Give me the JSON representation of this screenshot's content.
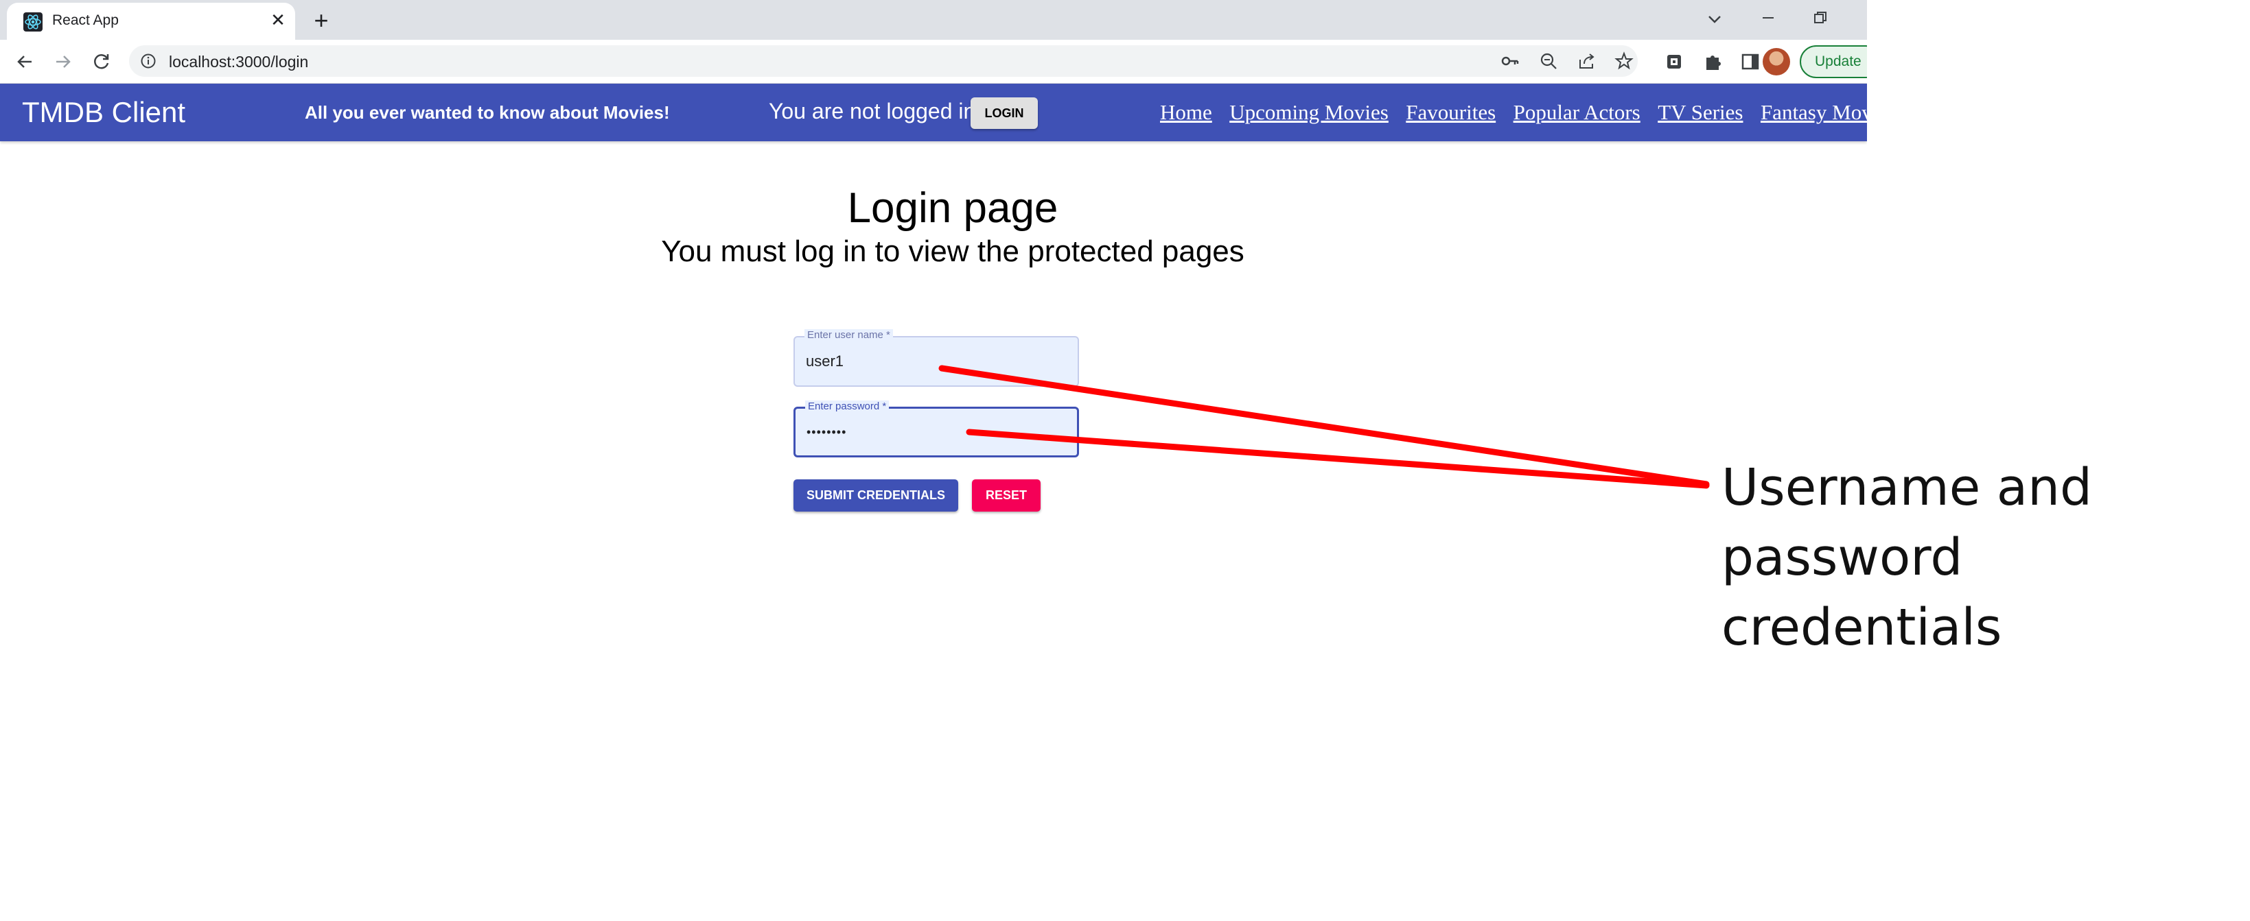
{
  "browser": {
    "tab_title": "React App",
    "tab_close": "✕",
    "new_tab": "+",
    "url": "localhost:3000/login",
    "update_label": "Update"
  },
  "appbar": {
    "title": "TMDB Client",
    "tagline": "All you ever wanted to know about Movies!",
    "login_status": "You are not logged in",
    "login_button": "LOGIN",
    "nav": [
      "Home",
      "Upcoming Movies",
      "Favourites",
      "Popular Actors",
      "TV Series",
      "Fantasy Movies"
    ]
  },
  "main": {
    "heading": "Login page",
    "subheading": "You must log in to view the protected pages",
    "username": {
      "label": "Enter user name *",
      "value": "user1"
    },
    "password": {
      "label": "Enter password *",
      "value": "••••••••"
    },
    "submit_label": "SUBMIT CREDENTIALS",
    "reset_label": "RESET"
  },
  "annotation": {
    "line1": "Username and",
    "line2": "password credentials",
    "color": "#ff0000"
  },
  "colors": {
    "primary": "#3f51b5",
    "secondary": "#f50057",
    "field_bg": "#e8f0fe"
  }
}
